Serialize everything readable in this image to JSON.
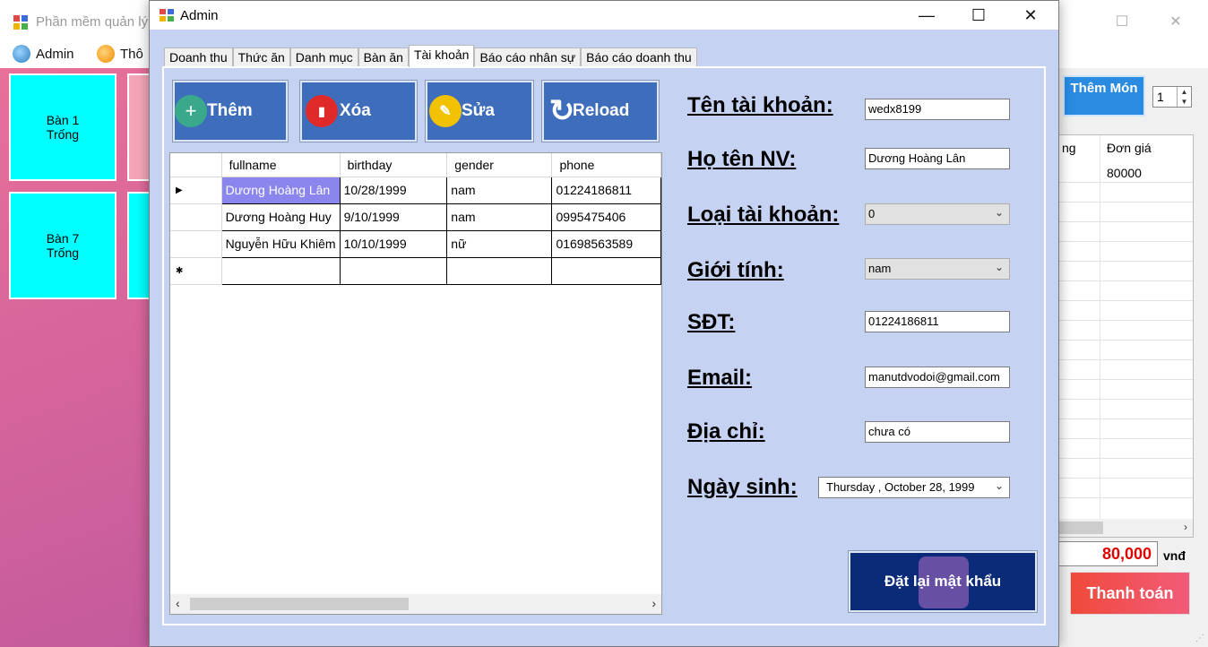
{
  "bg_window": {
    "title": "Phần mềm quản lý",
    "menu": [
      {
        "label": "Admin"
      },
      {
        "label": "Thô"
      }
    ],
    "tables": [
      {
        "name": "Bàn 1",
        "status": "Trống"
      },
      {
        "name": "Bàn 7",
        "status": "Trống"
      }
    ],
    "add_food_label": "Thêm Món",
    "quantity": "1",
    "bill_headers": [
      "ng",
      "Đơn giá"
    ],
    "bill_price": "80000",
    "total": "80,000",
    "currency": "vnđ",
    "pay_label": "Thanh toán"
  },
  "admin": {
    "title": "Admin",
    "tabs": [
      "Doanh thu",
      "Thức ăn",
      "Danh mục",
      "Bàn ăn",
      "Tài khoản",
      "Báo cáo nhân sự",
      "Báo cáo doanh thu"
    ],
    "active_tab": "Tài khoản",
    "buttons": {
      "add": "Thêm",
      "delete": "Xóa",
      "edit": "Sửa",
      "reload": "Reload"
    },
    "grid": {
      "columns": [
        "fullname",
        "birthday",
        "gender",
        "phone"
      ],
      "rows": [
        [
          "Dương Hoàng Lân",
          "10/28/1999",
          "nam",
          "01224186811"
        ],
        [
          "Dương Hoàng Huy",
          "9/10/1999",
          "nam",
          "0995475406"
        ],
        [
          "Nguyễn Hữu Khiêm",
          "10/10/1999",
          "nữ",
          "01698563589"
        ]
      ]
    },
    "form": {
      "username_label": "Tên tài khoản:",
      "username": "wedx8199",
      "fullname_label": "Họ tên NV:",
      "fullname": "Dương Hoàng Lân",
      "type_label": "Loại tài khoản:",
      "type": "0",
      "gender_label": "Giới tính:",
      "gender": "nam",
      "phone_label": "SĐT:",
      "phone": "01224186811",
      "email_label": "Email:",
      "email": "manutdvodoi@gmail.com",
      "address_label": "Địa chỉ:",
      "address": "chưa có",
      "birthday_label": "Ngày sinh:",
      "birthday": "Thursday ,  October  28, 1999"
    },
    "reset_label": "Đặt lại mật khẩu"
  }
}
